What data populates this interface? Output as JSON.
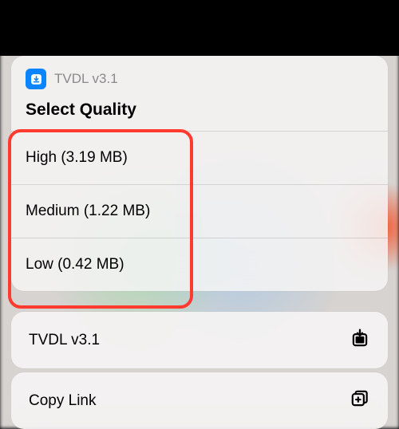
{
  "app": {
    "name": "TVDL v3.1",
    "heading": "Select Quality"
  },
  "qualityOptions": {
    "high": "High (3.19 MB)",
    "medium": "Medium (1.22 MB)",
    "low": "Low (0.42 MB)"
  },
  "actions": {
    "tvdl": "TVDL v3.1",
    "copyLink": "Copy Link"
  },
  "colors": {
    "highlight": "#ff3a2f",
    "accent": "#0a84ff"
  }
}
